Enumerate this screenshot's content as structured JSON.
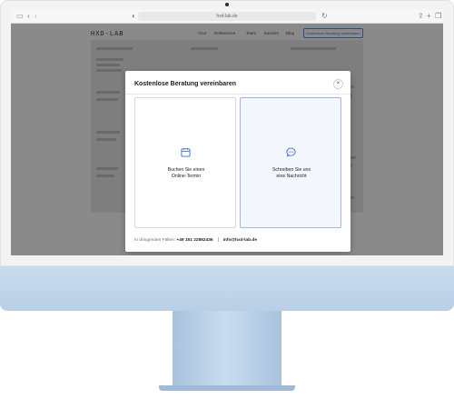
{
  "browser": {
    "url": "hxd-lab.de"
  },
  "site_nav": {
    "logo": "HXD-LAB",
    "links": [
      "Start",
      "Referenzen",
      "Team",
      "Karriere",
      "Blog"
    ],
    "cta": "Kostenlose Beratung vereinbaren"
  },
  "modal": {
    "title": "Kostenlose Beratung vereinbaren",
    "close_icon": "×",
    "options": [
      {
        "line1": "Buchen Sie einen",
        "line2": "Online-Termin",
        "icon": "calendar-icon",
        "icon_color": "#3a6fd8"
      },
      {
        "line1": "Schreiben Sie uns",
        "line2": "eine Nachricht",
        "icon": "chat-bubble-icon",
        "icon_color": "#3a6fd8"
      }
    ],
    "footer": {
      "prefix": "In dringenden Fällen:",
      "phone": "+49 151 22852436",
      "email": "info@hxd-lab.de"
    }
  },
  "colors": {
    "accent": "#3a6fd8",
    "overlay": "#7d7d7d",
    "monitor_chin": "#c2d6ec"
  }
}
